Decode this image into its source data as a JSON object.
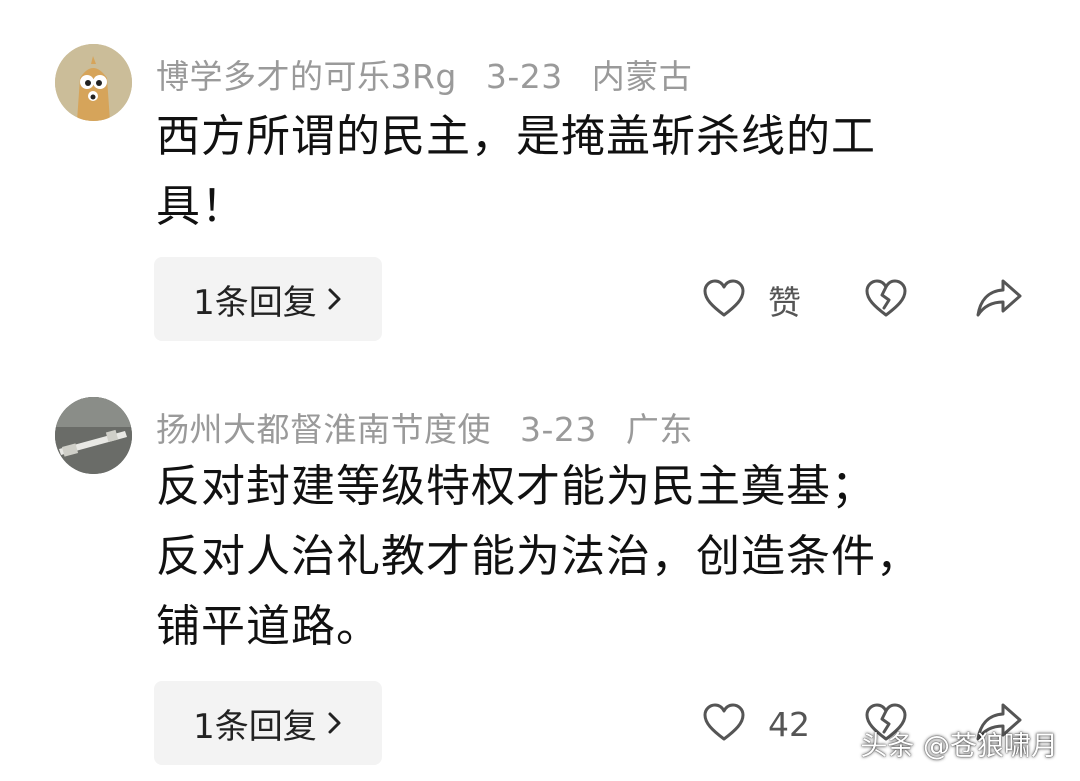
{
  "comments": [
    {
      "username": "博学多才的可乐3Rg",
      "date": "3-23",
      "location": "内蒙古",
      "text_lines": [
        "西方所谓的民主，是掩盖斩杀线的工",
        "具！"
      ],
      "reply_label": "1条回复",
      "like_label": "赞",
      "avatar": "cartoon-figure-avatar"
    },
    {
      "username": "扬州大都督淮南节度使",
      "date": "3-23",
      "location": "广东",
      "text_lines": [
        "反对封建等级特权才能为民主奠基；",
        "反对人治礼教才能为法治，创造条件，",
        "铺平道路。"
      ],
      "reply_label": "1条回复",
      "like_label": "42",
      "avatar": "photo-avatar"
    }
  ],
  "icons": {
    "like": "heart-icon",
    "dislike": "broken-heart-icon",
    "share": "share-arrow-icon",
    "reply_chevron": "chevron-right-icon"
  },
  "watermark": "头条 @苍狼啸月",
  "colors": {
    "meta_text": "#9a9a9a",
    "body_text": "#111111",
    "reply_bg": "#f3f3f3",
    "icon_stroke": "#555555"
  }
}
